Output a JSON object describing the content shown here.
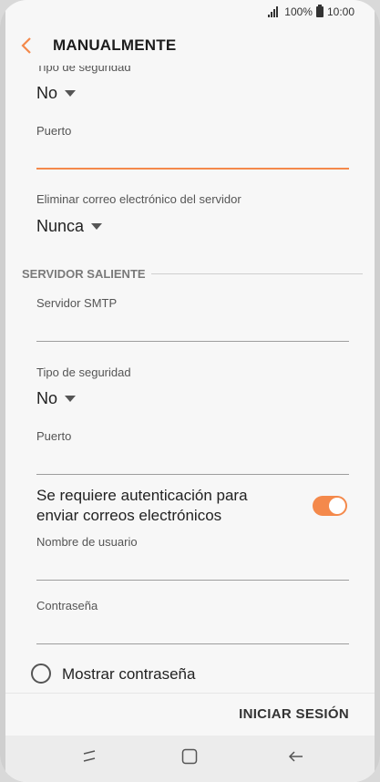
{
  "status_bar": {
    "battery_percent": "100%",
    "time": "10:00"
  },
  "app_bar": {
    "title": "MANUALMENTE"
  },
  "incoming": {
    "security_label_partial": "Tipo de seguridad",
    "security_value": "No",
    "port_label": "Puerto",
    "port_value": "",
    "delete_label": "Eliminar correo electrónico del servidor",
    "delete_value": "Nunca"
  },
  "outgoing": {
    "section_title": "SERVIDOR SALIENTE",
    "smtp_label": "Servidor SMTP",
    "smtp_value": "",
    "security_label": "Tipo de seguridad",
    "security_value": "No",
    "port_label": "Puerto",
    "port_value": "",
    "auth_text": "Se requiere autenticación para enviar correos electrónicos",
    "auth_toggle_on": true,
    "username_label": "Nombre de usuario",
    "username_value": "",
    "password_label": "Contraseña",
    "password_value": "",
    "show_password_label": "Mostrar contraseña"
  },
  "footer": {
    "signin_label": "INICIAR SESIÓN"
  },
  "colors": {
    "accent": "#f4894b",
    "background": "#f7f7f7",
    "text": "#222222"
  },
  "icons": {
    "back": "chevron-left-icon",
    "recent": "recent-apps-icon",
    "home": "home-icon",
    "nav_back": "nav-back-icon",
    "signal": "signal-icon",
    "battery": "battery-icon"
  }
}
